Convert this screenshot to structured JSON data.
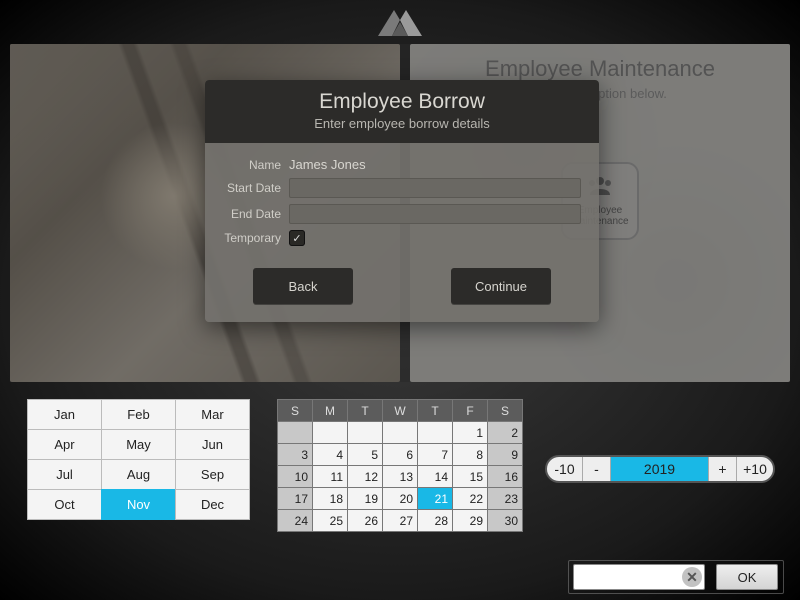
{
  "maintenance": {
    "title": "Employee Maintenance",
    "subtitle": "Select an option below.",
    "button": {
      "label_line1": "Employee",
      "label_line2": "Maintenance"
    }
  },
  "modal": {
    "title": "Employee Borrow",
    "subtitle": "Enter employee borrow details",
    "name_label": "Name",
    "name_value": "James Jones",
    "start_label": "Start Date",
    "end_label": "End Date",
    "temp_label": "Temporary",
    "temp_checked": "✓",
    "back": "Back",
    "continue": "Continue"
  },
  "months": {
    "items": [
      "Jan",
      "Feb",
      "Mar",
      "Apr",
      "May",
      "Jun",
      "Jul",
      "Aug",
      "Sep",
      "Oct",
      "Nov",
      "Dec"
    ],
    "selected": "Nov"
  },
  "calendar": {
    "weekdays": [
      "S",
      "M",
      "T",
      "W",
      "T",
      "F",
      "S"
    ],
    "leading_blanks": 5,
    "days": 30,
    "weekend_columns": [
      0,
      6
    ],
    "selected": 21
  },
  "year": {
    "minus10": "-10",
    "minus": "-",
    "value": "2019",
    "plus": "+",
    "plus10": "+10"
  },
  "bottom": {
    "input_value": "",
    "ok": "OK",
    "clear": "✕"
  }
}
